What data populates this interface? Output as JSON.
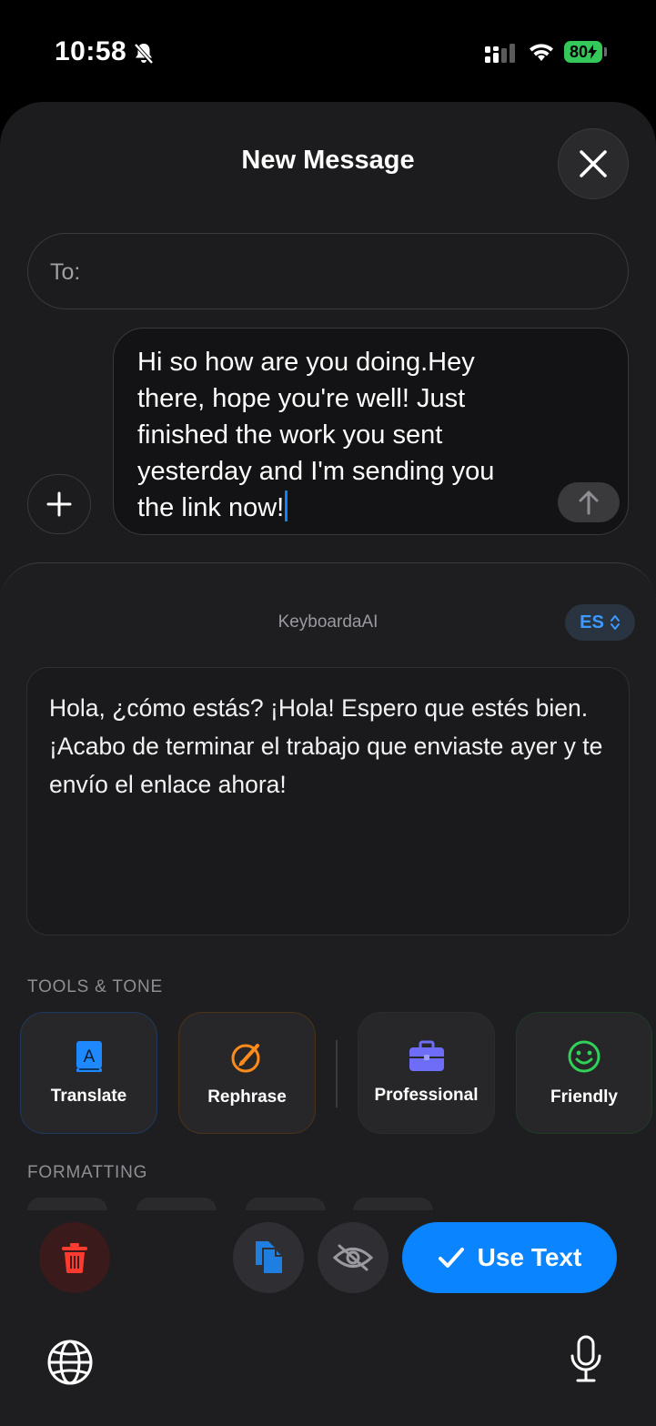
{
  "status_bar": {
    "time": "10:58",
    "battery": "80"
  },
  "header": {
    "title": "New Message"
  },
  "recipient": {
    "label": "To:"
  },
  "compose": {
    "text": "Hi so how are you doing.Hey there, hope you're well! Just finished the work you sent yesterday and I'm sending you the link now!"
  },
  "keyboard": {
    "brand": "KeyboardaAI",
    "language": "ES",
    "output_text": "Hola, ¿cómo estás? ¡Hola! Espero que estés bien. ¡Acabo de terminar el trabajo que enviaste ayer y te envío el enlace ahora!",
    "tools_label": "TOOLS & TONE",
    "tools": [
      {
        "label": "Translate",
        "icon": "translate-book-icon",
        "color": "#1e88ff"
      },
      {
        "label": "Rephrase",
        "icon": "rephrase-pencil-icon",
        "color": "#ff8c1a"
      },
      {
        "label": "Professional",
        "icon": "briefcase-icon",
        "color": "#6d6df7"
      },
      {
        "label": "Friendly",
        "icon": "smiley-icon",
        "color": "#30d158"
      }
    ],
    "formatting_label": "FORMATTING",
    "actions": {
      "delete_icon": "trash-icon",
      "copy_icon": "copy-icon",
      "hide_icon": "eye-slash-icon",
      "use_text_label": "Use Text"
    }
  },
  "system_keyboard": {
    "globe_icon": "globe-icon",
    "mic_icon": "microphone-icon"
  },
  "colors": {
    "accent": "#0a84ff",
    "sheet_bg": "#1c1c1e",
    "danger": "#ff3b30"
  }
}
